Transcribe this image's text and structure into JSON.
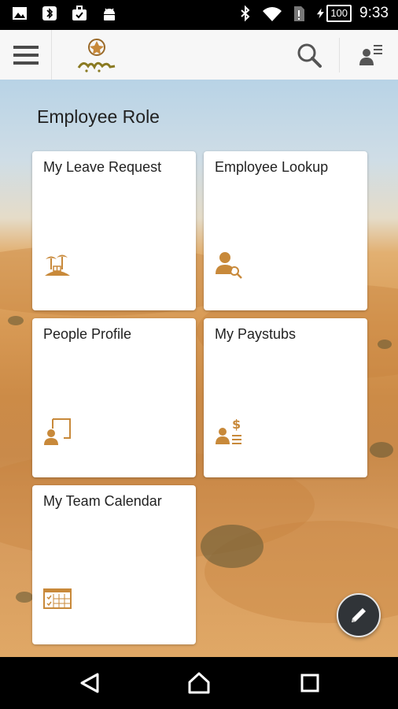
{
  "status_bar": {
    "time": "9:33",
    "battery": "100",
    "icons": [
      "image-icon",
      "bluetooth-notification-icon",
      "briefcase-check-icon",
      "android-icon",
      "bluetooth-icon",
      "wifi-icon",
      "sim-icon",
      "charging-icon"
    ]
  },
  "app_bar": {
    "menu_icon": "hamburger-menu-icon",
    "logo": "mawaridna-logo",
    "search_icon": "search-icon",
    "user_menu_icon": "user-menu-icon"
  },
  "main": {
    "section_title": "Employee Role",
    "tiles": [
      {
        "label": "My Leave Request",
        "icon": "vacation-icon"
      },
      {
        "label": "Employee Lookup",
        "icon": "person-search-icon"
      },
      {
        "label": "People Profile",
        "icon": "profile-frame-icon"
      },
      {
        "label": "My Paystubs",
        "icon": "paystub-icon"
      },
      {
        "label": "My Team Calendar",
        "icon": "calendar-icon"
      }
    ],
    "fab_icon": "pencil-icon"
  },
  "nav_bar": {
    "back_icon": "back-icon",
    "home_icon": "home-icon",
    "recents_icon": "recents-icon"
  },
  "colors": {
    "accent": "#c8893a",
    "tile_bg": "#ffffff",
    "fab_bg": "#303438",
    "app_bar_bg": "#f7f7f7"
  }
}
